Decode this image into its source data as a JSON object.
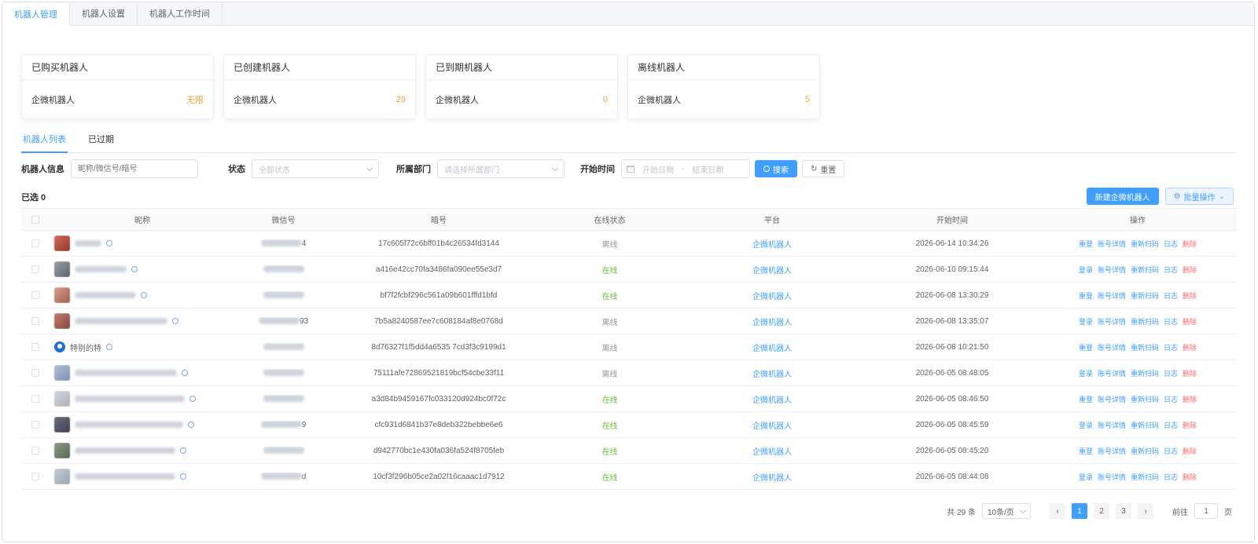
{
  "top_tabs": [
    "机器人管理",
    "机器人设置",
    "机器人工作时间"
  ],
  "cards": [
    {
      "title": "已购买机器人",
      "label": "企微机器人",
      "value": "无限"
    },
    {
      "title": "已创建机器人",
      "label": "企微机器人",
      "value": "29"
    },
    {
      "title": "已到期机器人",
      "label": "企微机器人",
      "value": "0"
    },
    {
      "title": "离线机器人",
      "label": "企微机器人",
      "value": "5"
    }
  ],
  "sub_tabs": [
    "机器人列表",
    "已过期"
  ],
  "filters": {
    "robot_info_label": "机器人信息",
    "robot_info_placeholder": "昵称/微信号/暗号",
    "status_label": "状态",
    "status_placeholder": "全部状态",
    "dept_label": "所属部门",
    "dept_placeholder": "请选择所属部门",
    "time_label": "开始时间",
    "start_placeholder": "开始日期",
    "dash": "-",
    "end_placeholder": "结束日期",
    "search_label": "搜索",
    "reset_label": "重置"
  },
  "selected_text": "已选 0",
  "actions": {
    "add_label": "新建企微机器人",
    "batch_label": "批量操作"
  },
  "columns": [
    "昵称",
    "微信号",
    "暗号",
    "在线状态",
    "平台",
    "开始时间",
    "操作"
  ],
  "rows": [
    {
      "name": "",
      "wx_suffix": "4",
      "code": "17c605f72c6bff01b4c26534fd3144",
      "status": "离线",
      "platform": "企微机器人",
      "time": "2026-06-14 10:34:26",
      "first_op": "重登"
    },
    {
      "name": "",
      "wx_suffix": "",
      "code": "a416e42cc70fa3486fa090ee55e3d7",
      "status": "在线",
      "platform": "企微机器人",
      "time": "2026-06-10 09:15:44",
      "first_op": "登录"
    },
    {
      "name": "",
      "wx_suffix": "",
      "code": "bf7f2fcbf296c561a09b601fffd1bfd",
      "status": "在线",
      "platform": "企微机器人",
      "time": "2026-06-08 13:30:29",
      "first_op": "重登"
    },
    {
      "name": "",
      "wx_suffix": "93",
      "code": "7b5a8240587ee7c608184af8e0768d",
      "status": "离线",
      "platform": "企微机器人",
      "time": "2026-06-08 13:35:07",
      "first_op": "登录"
    },
    {
      "name": "特别的特",
      "wx_suffix": "",
      "code": "8d76327f1f5dd4a6535 7cd3f3c9199d1",
      "status": "离线",
      "platform": "企微机器人",
      "time": "2026-06-08 10:21:50",
      "first_op": "重登"
    },
    {
      "name": "",
      "wx_suffix": "",
      "code": "75111afe72869521819bcf54cbe33f11",
      "status": "离线",
      "platform": "企微机器人",
      "time": "2026-06-05 08:48:05",
      "first_op": "登录"
    },
    {
      "name": "",
      "wx_suffix": "",
      "code": "a3d84b9459167fc033120d924bc0f72c",
      "status": "在线",
      "platform": "企微机器人",
      "time": "2026-06-05 08:46:50",
      "first_op": "重登"
    },
    {
      "name": "",
      "wx_suffix": "9",
      "code": "cfc931d6841b37e8deb322bebbe6e6",
      "status": "在线",
      "platform": "企微机器人",
      "time": "2026-06-05 08:45:59",
      "first_op": "登录"
    },
    {
      "name": "",
      "wx_suffix": "",
      "code": "d942770bc1e430fa036fa524f8705feb",
      "status": "在线",
      "platform": "企微机器人",
      "time": "2026-06-05 08:45:20",
      "first_op": "重登"
    },
    {
      "name": "",
      "wx_suffix": "d",
      "code": "10cf3f296b05ce2a02f16caaac1d7912",
      "status": "在线",
      "platform": "企微机器人",
      "time": "2026-06-05 08:44:08",
      "first_op": "登录"
    }
  ],
  "row_ops": [
    "账号详情",
    "重新扫码",
    "日志",
    "删除"
  ],
  "pagination": {
    "total": "共 29 条",
    "page_size": "10条/页",
    "prev": "‹",
    "pages": [
      "1",
      "2",
      "3"
    ],
    "next": "›",
    "goto_label": "前往",
    "goto_value": "1",
    "page_unit": "页"
  },
  "colors": {
    "primary": "#409eff",
    "online": "#67c23a",
    "danger": "#f56c6c",
    "warning": "#e6a23c"
  }
}
